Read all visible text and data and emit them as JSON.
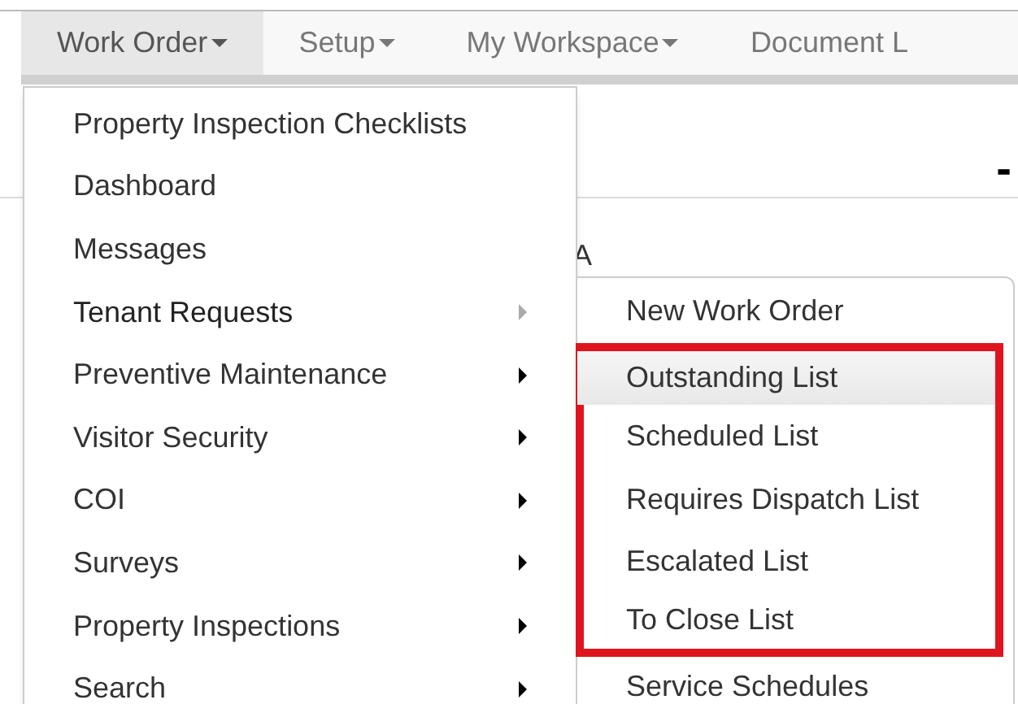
{
  "nav": [
    {
      "label": "Work Order",
      "selected": true
    },
    {
      "label": "Setup",
      "selected": false
    },
    {
      "label": "My Workspace",
      "selected": false
    },
    {
      "label": "Document L",
      "selected": false
    }
  ],
  "page": {
    "heading_fragment": "-",
    "text_fragment": "A"
  },
  "menu": [
    {
      "label": "Property Inspection Checklists",
      "submenu": false,
      "expanded": false
    },
    {
      "label": "Dashboard",
      "submenu": false,
      "expanded": false
    },
    {
      "label": "Messages",
      "submenu": false,
      "expanded": false
    },
    {
      "label": "Tenant Requests",
      "submenu": true,
      "expanded": true
    },
    {
      "label": "Preventive Maintenance",
      "submenu": true,
      "expanded": false
    },
    {
      "label": "Visitor Security",
      "submenu": true,
      "expanded": false
    },
    {
      "label": "COI",
      "submenu": true,
      "expanded": false
    },
    {
      "label": "Surveys",
      "submenu": true,
      "expanded": false
    },
    {
      "label": "Property Inspections",
      "submenu": true,
      "expanded": false
    },
    {
      "label": "Search",
      "submenu": true,
      "expanded": false
    }
  ],
  "submenu": [
    {
      "label": "New Work Order",
      "selected": false,
      "highlighted": false
    },
    {
      "label": "Outstanding List",
      "selected": true,
      "highlighted": true
    },
    {
      "label": "Scheduled List",
      "selected": false,
      "highlighted": true
    },
    {
      "label": "Requires Dispatch List",
      "selected": false,
      "highlighted": true
    },
    {
      "label": "Escalated List",
      "selected": false,
      "highlighted": true
    },
    {
      "label": "To Close List",
      "selected": false,
      "highlighted": true
    },
    {
      "label": "Service Schedules",
      "selected": false,
      "highlighted": false
    }
  ]
}
